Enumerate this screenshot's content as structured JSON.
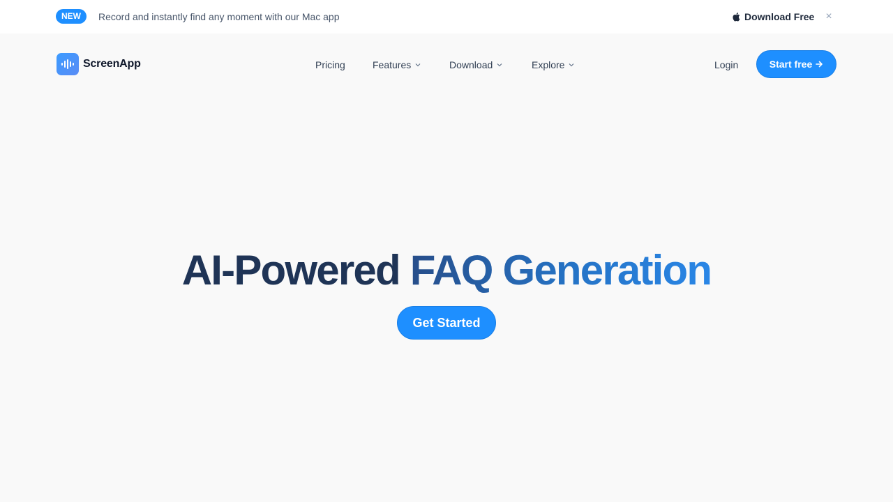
{
  "announcement": {
    "badge": "NEW",
    "message": "Record and instantly find any moment with our Mac app",
    "download_label": "Download Free",
    "close_symbol": "×",
    "download_icon": "apple-icon"
  },
  "brand": {
    "name": "ScreenApp",
    "icon": "soundwave-icon",
    "accent": "#1e8fff"
  },
  "nav": {
    "pricing": "Pricing",
    "features": "Features",
    "download": "Download",
    "explore": "Explore",
    "login": "Login",
    "start_free": "Start free"
  },
  "hero": {
    "title_part1": "AI-Powered",
    "title_part2": "FAQ Generation",
    "cta": "Get Started"
  }
}
